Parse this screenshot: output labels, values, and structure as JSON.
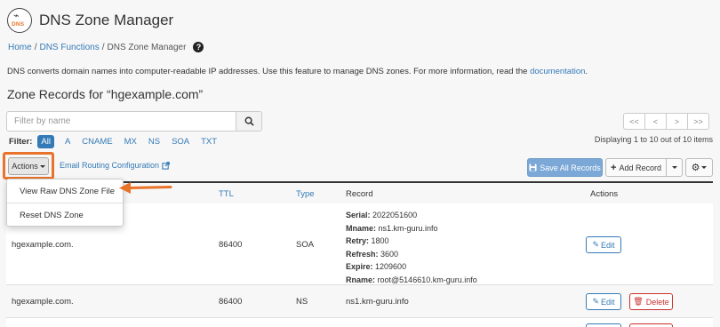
{
  "header": {
    "title": "DNS Zone Manager",
    "logo_text": "DNS"
  },
  "breadcrumb": {
    "items": [
      "Home",
      "DNS Functions",
      "DNS Zone Manager"
    ],
    "separator": "/",
    "help": "?"
  },
  "description": {
    "text": "DNS converts domain names into computer-readable IP addresses. Use this feature to manage DNS zones. For more information, read the ",
    "link": "documentation",
    "tail": "."
  },
  "zone": {
    "title": "Zone Records for “hgexample.com”"
  },
  "search": {
    "placeholder": "Filter by name"
  },
  "pager": {
    "first": "<<",
    "prev": "<",
    "next": ">",
    "last": ">>"
  },
  "filter": {
    "label": "Filter:",
    "chips": [
      "All",
      "A",
      "CNAME",
      "MX",
      "NS",
      "SOA",
      "TXT"
    ],
    "active": "All"
  },
  "displaying": "Displaying 1 to 10 out of 10 items",
  "toolbar": {
    "actions_label": "Actions",
    "email_routing": "Email Routing Configuration",
    "save_all": "Save All Records",
    "add_record": "Add Record",
    "accent_color": "#e8732a"
  },
  "dropdown": {
    "items": [
      "View Raw DNS Zone File",
      "Reset DNS Zone"
    ]
  },
  "table": {
    "headers": {
      "ttl": "TTL",
      "type": "Type",
      "record": "Record",
      "actions": "Actions"
    },
    "rows": [
      {
        "name": "hgexample.com.",
        "ttl": "86400",
        "type": "SOA",
        "record": [
          {
            "key": "Serial:",
            "value": "2022051600"
          },
          {
            "key": "Mname:",
            "value": "ns1.km-guru.info"
          },
          {
            "key": "Retry:",
            "value": "1800"
          },
          {
            "key": "Refresh:",
            "value": "3600"
          },
          {
            "key": "Expire:",
            "value": "1209600"
          },
          {
            "key": "Rname:",
            "value": "root@5146610.km-guru.info"
          }
        ],
        "edit": "Edit"
      },
      {
        "name": "hgexample.com.",
        "ttl": "86400",
        "type": "NS",
        "record_text": "ns1.km-guru.info",
        "edit": "Edit",
        "delete": "Delete"
      }
    ]
  }
}
